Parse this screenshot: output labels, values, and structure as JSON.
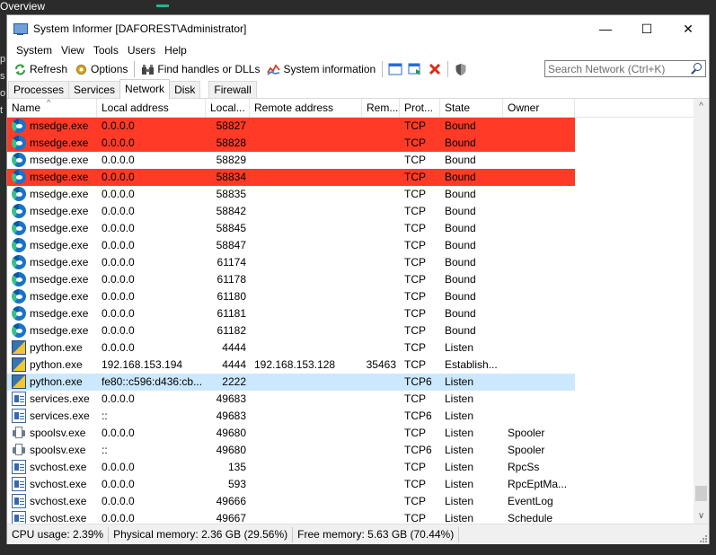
{
  "background": {
    "overview_label": "Overview",
    "left_letters": [
      "p",
      "s",
      "o",
      "t"
    ]
  },
  "window": {
    "title": "System Informer [DAFOREST\\Administrator]",
    "minimize": "—",
    "maximize": "☐",
    "close": "✕"
  },
  "menu": [
    "System",
    "View",
    "Tools",
    "Users",
    "Help"
  ],
  "toolbar": {
    "refresh": "Refresh",
    "options": "Options",
    "find_handles": "Find handles or DLLs",
    "system_information": "System information",
    "search_placeholder": "Search Network (Ctrl+K)"
  },
  "tabs": [
    "Processes",
    "Services",
    "Network",
    "Disk",
    "Firewall"
  ],
  "active_tab": "Network",
  "columns": [
    "Name",
    "Local address",
    "Local...",
    "Remote address",
    "Rem...",
    "Prot...",
    "State",
    "Owner"
  ],
  "rows": [
    {
      "icon": "edge-icon",
      "name": "msedge.exe",
      "local": "0.0.0.0",
      "lport": "58827",
      "remote": "",
      "rport": "",
      "proto": "TCP",
      "state": "Bound",
      "owner": "",
      "hl": "red"
    },
    {
      "icon": "edge-icon",
      "name": "msedge.exe",
      "local": "0.0.0.0",
      "lport": "58828",
      "remote": "",
      "rport": "",
      "proto": "TCP",
      "state": "Bound",
      "owner": "",
      "hl": "red"
    },
    {
      "icon": "edge-icon",
      "name": "msedge.exe",
      "local": "0.0.0.0",
      "lport": "58829",
      "remote": "",
      "rport": "",
      "proto": "TCP",
      "state": "Bound",
      "owner": "",
      "hl": ""
    },
    {
      "icon": "edge-icon",
      "name": "msedge.exe",
      "local": "0.0.0.0",
      "lport": "58834",
      "remote": "",
      "rport": "",
      "proto": "TCP",
      "state": "Bound",
      "owner": "",
      "hl": "red"
    },
    {
      "icon": "edge-icon",
      "name": "msedge.exe",
      "local": "0.0.0.0",
      "lport": "58835",
      "remote": "",
      "rport": "",
      "proto": "TCP",
      "state": "Bound",
      "owner": "",
      "hl": ""
    },
    {
      "icon": "edge-icon",
      "name": "msedge.exe",
      "local": "0.0.0.0",
      "lport": "58842",
      "remote": "",
      "rport": "",
      "proto": "TCP",
      "state": "Bound",
      "owner": "",
      "hl": ""
    },
    {
      "icon": "edge-icon",
      "name": "msedge.exe",
      "local": "0.0.0.0",
      "lport": "58845",
      "remote": "",
      "rport": "",
      "proto": "TCP",
      "state": "Bound",
      "owner": "",
      "hl": ""
    },
    {
      "icon": "edge-icon",
      "name": "msedge.exe",
      "local": "0.0.0.0",
      "lport": "58847",
      "remote": "",
      "rport": "",
      "proto": "TCP",
      "state": "Bound",
      "owner": "",
      "hl": ""
    },
    {
      "icon": "edge-icon",
      "name": "msedge.exe",
      "local": "0.0.0.0",
      "lport": "61174",
      "remote": "",
      "rport": "",
      "proto": "TCP",
      "state": "Bound",
      "owner": "",
      "hl": ""
    },
    {
      "icon": "edge-icon",
      "name": "msedge.exe",
      "local": "0.0.0.0",
      "lport": "61178",
      "remote": "",
      "rport": "",
      "proto": "TCP",
      "state": "Bound",
      "owner": "",
      "hl": ""
    },
    {
      "icon": "edge-icon",
      "name": "msedge.exe",
      "local": "0.0.0.0",
      "lport": "61180",
      "remote": "",
      "rport": "",
      "proto": "TCP",
      "state": "Bound",
      "owner": "",
      "hl": ""
    },
    {
      "icon": "edge-icon",
      "name": "msedge.exe",
      "local": "0.0.0.0",
      "lport": "61181",
      "remote": "",
      "rport": "",
      "proto": "TCP",
      "state": "Bound",
      "owner": "",
      "hl": ""
    },
    {
      "icon": "edge-icon",
      "name": "msedge.exe",
      "local": "0.0.0.0",
      "lport": "61182",
      "remote": "",
      "rport": "",
      "proto": "TCP",
      "state": "Bound",
      "owner": "",
      "hl": ""
    },
    {
      "icon": "python-icon",
      "name": "python.exe",
      "local": "0.0.0.0",
      "lport": "4444",
      "remote": "",
      "rport": "",
      "proto": "TCP",
      "state": "Listen",
      "owner": "",
      "hl": ""
    },
    {
      "icon": "python-icon",
      "name": "python.exe",
      "local": "192.168.153.194",
      "lport": "4444",
      "remote": "192.168.153.128",
      "rport": "35463",
      "proto": "TCP",
      "state": "Establish...",
      "owner": "",
      "hl": ""
    },
    {
      "icon": "python-icon",
      "name": "python.exe",
      "local": "fe80::c596:d436:cb...",
      "lport": "2222",
      "remote": "",
      "rport": "",
      "proto": "TCP6",
      "state": "Listen",
      "owner": "",
      "hl": "blue"
    },
    {
      "icon": "service-icon",
      "name": "services.exe",
      "local": "0.0.0.0",
      "lport": "49683",
      "remote": "",
      "rport": "",
      "proto": "TCP",
      "state": "Listen",
      "owner": "",
      "hl": ""
    },
    {
      "icon": "service-icon",
      "name": "services.exe",
      "local": "::",
      "lport": "49683",
      "remote": "",
      "rport": "",
      "proto": "TCP6",
      "state": "Listen",
      "owner": "",
      "hl": ""
    },
    {
      "icon": "printer-icon",
      "name": "spoolsv.exe",
      "local": "0.0.0.0",
      "lport": "49680",
      "remote": "",
      "rport": "",
      "proto": "TCP",
      "state": "Listen",
      "owner": "Spooler",
      "hl": ""
    },
    {
      "icon": "printer-icon",
      "name": "spoolsv.exe",
      "local": "::",
      "lport": "49680",
      "remote": "",
      "rport": "",
      "proto": "TCP6",
      "state": "Listen",
      "owner": "Spooler",
      "hl": ""
    },
    {
      "icon": "service-icon",
      "name": "svchost.exe",
      "local": "0.0.0.0",
      "lport": "135",
      "remote": "",
      "rport": "",
      "proto": "TCP",
      "state": "Listen",
      "owner": "RpcSs",
      "hl": ""
    },
    {
      "icon": "service-icon",
      "name": "svchost.exe",
      "local": "0.0.0.0",
      "lport": "593",
      "remote": "",
      "rport": "",
      "proto": "TCP",
      "state": "Listen",
      "owner": "RpcEptMa...",
      "hl": ""
    },
    {
      "icon": "service-icon",
      "name": "svchost.exe",
      "local": "0.0.0.0",
      "lport": "49666",
      "remote": "",
      "rport": "",
      "proto": "TCP",
      "state": "Listen",
      "owner": "EventLog",
      "hl": ""
    },
    {
      "icon": "service-icon",
      "name": "svchost.exe",
      "local": "0.0.0.0",
      "lport": "49667",
      "remote": "",
      "rport": "",
      "proto": "TCP",
      "state": "Listen",
      "owner": "Schedule",
      "hl": ""
    }
  ],
  "status": {
    "cpu": "CPU usage: 2.39%",
    "physical": "Physical memory: 2.36 GB (29.56%)",
    "free": "Free memory: 5.63 GB (70.44%)"
  },
  "colors": {
    "highlight_red": "#ff3a26",
    "highlight_blue": "#cce8ff"
  }
}
